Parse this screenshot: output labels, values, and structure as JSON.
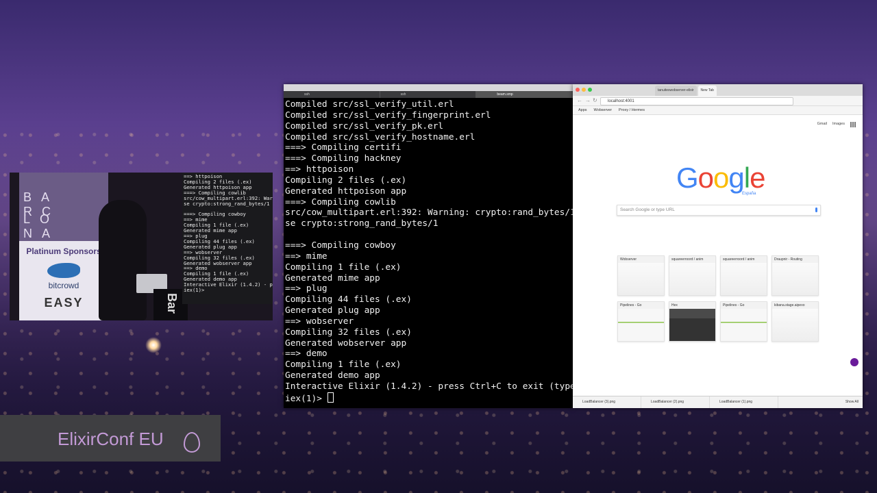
{
  "speaker_video": {
    "banner_top": "BA RC",
    "banner_mid": "LO NA",
    "banner_sub": "Platinum Sponsors",
    "sponsor1": "bitcrowd",
    "sponsor2": "EASY",
    "podium_text": "Bar",
    "mini_terminal": "==> httpoison\nCompiling 2 files (.ex)\nGenerated httpoison app\n===> Compiling cowlib\nsrc/cow_multipart.erl:392: Warning: cr\nse crypto:strong_rand_bytes/1\n\n===> Compiling cowboy\n==> mime\nCompiling 1 file (.ex)\nGenerated mime app\n==> plug\nCompiling 44 files (.ex)\nGenerated plug app\n==> wobserver\nCompiling 32 files (.ex)\nGenerated wobserver app\n==> demo\nCompiling 1 file (.ex)\nGenerated demo app\nInteractive Elixir (1.4.2) - press Ctr\niex(1)> "
  },
  "conf_logo": {
    "text": "ElixirConf EU"
  },
  "terminal": {
    "tabs": [
      "ssh",
      "ssh",
      "beam.smp"
    ],
    "lines": [
      "Compiled src/ssl_verify_util.erl",
      "Compiled src/ssl_verify_fingerprint.erl",
      "Compiled src/ssl_verify_pk.erl",
      "Compiled src/ssl_verify_hostname.erl",
      "===> Compiling certifi",
      "===> Compiling hackney",
      "==> httpoison",
      "Compiling 2 files (.ex)",
      "Generated httpoison app",
      "===> Compiling cowlib",
      "src/cow_multipart.erl:392: Warning: crypto:rand_bytes/1",
      "se crypto:strong_rand_bytes/1",
      "",
      "===> Compiling cowboy",
      "==> mime",
      "Compiling 1 file (.ex)",
      "Generated mime app",
      "==> plug",
      "Compiling 44 files (.ex)",
      "Generated plug app",
      "==> wobserver",
      "Compiling 32 files (.ex)",
      "Generated wobserver app",
      "==> demo",
      "Compiling 1 file (.ex)",
      "Generated demo app",
      "Interactive Elixir (1.4.2) - press Ctrl+C to exit (type"
    ],
    "prompt": "iex(1)> "
  },
  "browser": {
    "tabs": [
      {
        "label": "tanuiteswobserver-elixir"
      },
      {
        "label": "New Tab"
      }
    ],
    "url": "localhost:4001",
    "bookmarks": [
      "Apps",
      "Wobserver",
      "Proxy / Hermes"
    ],
    "top_links": [
      "Gmail",
      "Images"
    ],
    "logo": "Google",
    "logo_sub": "España",
    "search_placeholder": "Search Google or type URL",
    "tiles": [
      {
        "title": "Wobserver",
        "style": "blank"
      },
      {
        "title": "squareerroord / anim",
        "style": "light"
      },
      {
        "title": "squareerroord / anim",
        "style": "light"
      },
      {
        "title": "Draupnir - Routing",
        "style": "light"
      },
      {
        "title": "Pipelines - Go",
        "style": "pipe"
      },
      {
        "title": "Hex",
        "style": "dark"
      },
      {
        "title": "Pipelines - Go",
        "style": "pipe"
      },
      {
        "title": "kibana.stage.aipexo",
        "style": "blank"
      }
    ],
    "downloads": [
      "LoadBalancer (3).png",
      "LoadBalancer (2).png",
      "LoadBalancer (1).png"
    ],
    "show_all": "Show All"
  },
  "colors": {
    "google_blue": "#4285f4",
    "google_red": "#ea4335",
    "google_yellow": "#fbbc05",
    "google_green": "#34a853",
    "conf_purple": "#c39ad6"
  }
}
